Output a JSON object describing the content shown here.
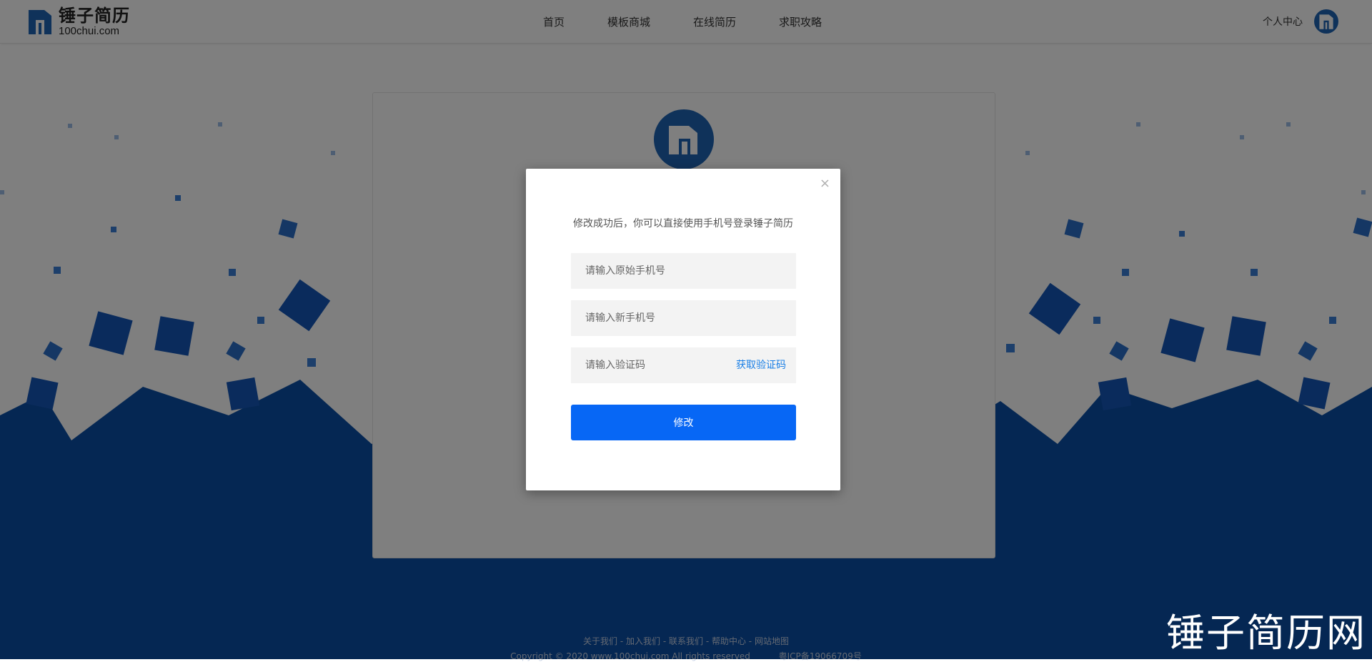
{
  "header": {
    "logo_cn": "锤子简历",
    "logo_en": "100chui.com",
    "nav": [
      "首页",
      "模板商城",
      "在线简历",
      "求职攻略"
    ],
    "user_label": "个人中心"
  },
  "modal": {
    "tip": "修改成功后，你可以直接使用手机号登录锤子简历",
    "old_phone_placeholder": "请输入原始手机号",
    "new_phone_placeholder": "请输入新手机号",
    "code_placeholder": "请输入验证码",
    "get_code_label": "获取验证码",
    "submit_label": "修改",
    "close_label": "×"
  },
  "footer": {
    "links": [
      "关于我们",
      "加入我们",
      "联系我们",
      "帮助中心",
      "网站地图"
    ],
    "separator": " - ",
    "copyright": "Copyright © 2020 www.100chui.com All rights reserved",
    "icp": "粤ICP备19066709号"
  },
  "watermark": "锤子简历网",
  "colors": {
    "brand_blue": "#0767f5",
    "deep_blue": "#0b4fa6",
    "link_blue": "#1a7fe6"
  },
  "icons": {
    "logo": "hammer-logo-icon",
    "avatar": "user-avatar-icon",
    "close": "close-icon"
  }
}
